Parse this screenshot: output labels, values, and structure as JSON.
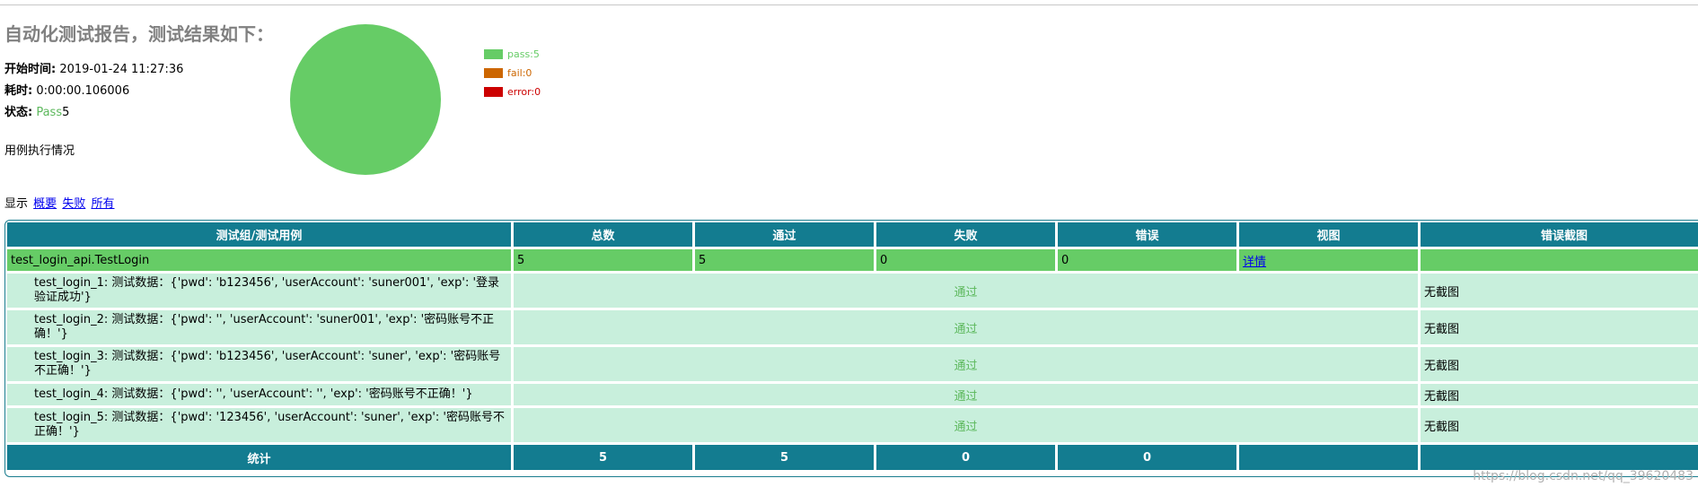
{
  "report": {
    "title": "自动化测试报告，测试结果如下：",
    "start_label": "开始时间:",
    "start_value": " 2019-01-24 11:27:36",
    "duration_label": "耗时:",
    "duration_value": " 0:00:00.106006",
    "status_label": "状态:",
    "status_pass_word": " Pass",
    "status_count": "5",
    "section_label": "用例执行情况",
    "filter_label": "显示",
    "filter_links": [
      "概要",
      "失败",
      "所有"
    ]
  },
  "pie": {
    "slices": [
      {
        "label": "pass:5",
        "value": 5,
        "color": "#66cc66"
      },
      {
        "label": "fail:0",
        "value": 0,
        "color": "#cc6600"
      },
      {
        "label": "error:0",
        "value": 0,
        "color": "#cc0000"
      }
    ]
  },
  "table": {
    "headers": [
      "测试组/测试用例",
      "总数",
      "通过",
      "失败",
      "错误",
      "视图",
      "错误截图"
    ],
    "group": {
      "name": "test_login_api.TestLogin",
      "total": "5",
      "pass": "5",
      "fail": "0",
      "error": "0",
      "detail_link": "详情",
      "screenshot": ""
    },
    "cases": [
      {
        "name": "test_login_1: 测试数据：{'pwd': 'b123456', 'userAccount': 'suner001', 'exp': '登录验证成功'}",
        "status": "通过",
        "screenshot": "无截图"
      },
      {
        "name": "test_login_2: 测试数据：{'pwd': '', 'userAccount': 'suner001', 'exp': '密码账号不正确！'}",
        "status": "通过",
        "screenshot": "无截图"
      },
      {
        "name": "test_login_3: 测试数据：{'pwd': 'b123456', 'userAccount': 'suner', 'exp': '密码账号不正确！'}",
        "status": "通过",
        "screenshot": "无截图"
      },
      {
        "name": "test_login_4: 测试数据：{'pwd': '', 'userAccount': '', 'exp': '密码账号不正确！'}",
        "status": "通过",
        "screenshot": "无截图"
      },
      {
        "name": "test_login_5: 测试数据：{'pwd': '123456', 'userAccount': 'suner', 'exp': '密码账号不正确！'}",
        "status": "通过",
        "screenshot": "无截图"
      }
    ],
    "totals": {
      "label": "统计",
      "total": "5",
      "pass": "5",
      "fail": "0",
      "error": "0"
    }
  },
  "watermark": "https://blog.csdn.net/qq_39620483"
}
